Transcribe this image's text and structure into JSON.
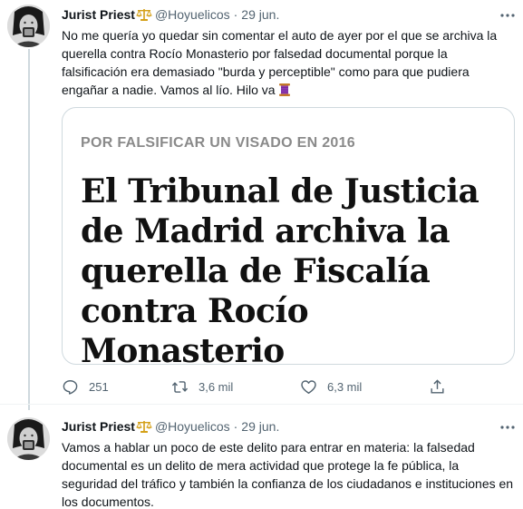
{
  "tweets": [
    {
      "author_name": "Jurist Priest",
      "author_badge_icon": "balance-scale-emoji",
      "handle": "@Hoyuelicos",
      "separator": "·",
      "date": "29 jun.",
      "text": "No me quería yo quedar sin comentar el auto de ayer por el que se archiva la querella contra Rocío Monasterio por falsedad documental porque la falsificación era demasiado \"burda y perceptible\" como para que pudiera engañar a nadie. Vamos al lío. Hilo va",
      "text_trailing_icon": "thread-spool-emoji",
      "card": {
        "kicker": "POR FALSIFICAR UN VISADO EN 2016",
        "headline_lines": [
          "El Tribunal de Justicia",
          "de Madrid archiva la",
          "querella de Fiscalía",
          "contra Rocío",
          "Monasterio"
        ]
      },
      "actions": {
        "reply_icon": "reply-icon",
        "reply_count": "251",
        "retweet_icon": "retweet-icon",
        "retweet_count": "3,6 mil",
        "like_icon": "heart-icon",
        "like_count": "6,3 mil",
        "share_icon": "share-icon"
      }
    },
    {
      "author_name": "Jurist Priest",
      "author_badge_icon": "balance-scale-emoji",
      "handle": "@Hoyuelicos",
      "separator": "·",
      "date": "29 jun.",
      "text": "Vamos a hablar un poco de este delito para entrar en materia: la falsedad documental es un delito de mera actividad que protege la fe pública, la seguridad del tráfico y también la confianza de los ciudadanos e instituciones en los documentos."
    }
  ],
  "colors": {
    "text_primary": "#0f1419",
    "text_secondary": "#536471",
    "border": "#cfd9de",
    "card_kicker": "#8a8a8a"
  }
}
